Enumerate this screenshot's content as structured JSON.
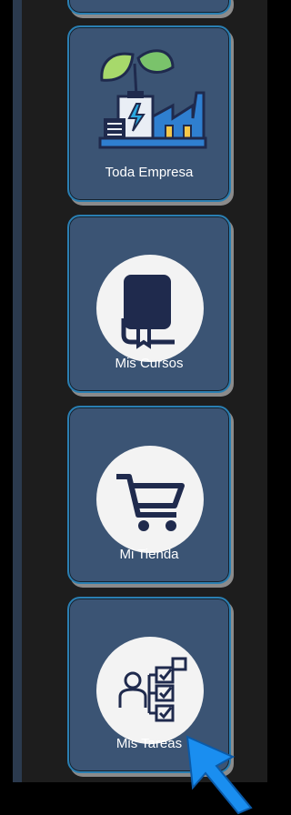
{
  "tiles": [
    {
      "label": "Toda Empresa",
      "icon": "factory-icon"
    },
    {
      "label": "Mis Cursos",
      "icon": "book-icon"
    },
    {
      "label": "Mi Tienda",
      "icon": "cart-icon"
    },
    {
      "label": "Mis Tareas",
      "icon": "tasks-icon"
    }
  ],
  "colors": {
    "tile_bg": "#3b5474",
    "tile_border": "#2a7fb2",
    "icon_dark": "#1f2a4d",
    "cursor": "#1a8ef0"
  }
}
